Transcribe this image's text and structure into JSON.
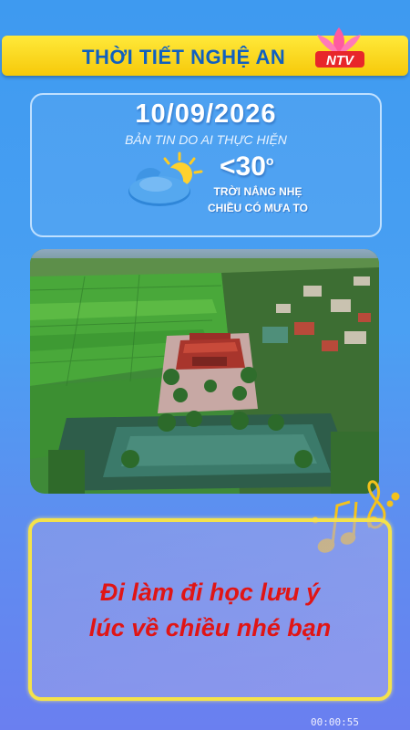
{
  "header": {
    "title": "THỜI TIẾT NGHỆ AN",
    "logo_text": "NTV"
  },
  "weather": {
    "date": "10/09/2026",
    "subtitle": "BẢN TIN DO AI THỰC HIỆN",
    "temperature": "<30",
    "temperature_unit": "o",
    "condition_line1": "TRỜI NẮNG NHẸ",
    "condition_line2": "CHIỀU CÓ MƯA TO",
    "icon": "partly-cloudy-icon"
  },
  "photo": {
    "subject": "aerial-temple-photo"
  },
  "message": {
    "line1": "Đi làm đi học lưu ý",
    "line2": "lúc về chiều nhé bạn"
  },
  "decoration": {
    "icon": "music-notes-icon"
  },
  "timestamp": "00:00:55",
  "colors": {
    "accent_yellow": "#f6c90a",
    "title_blue": "#1060c0",
    "message_red": "#e01515"
  }
}
